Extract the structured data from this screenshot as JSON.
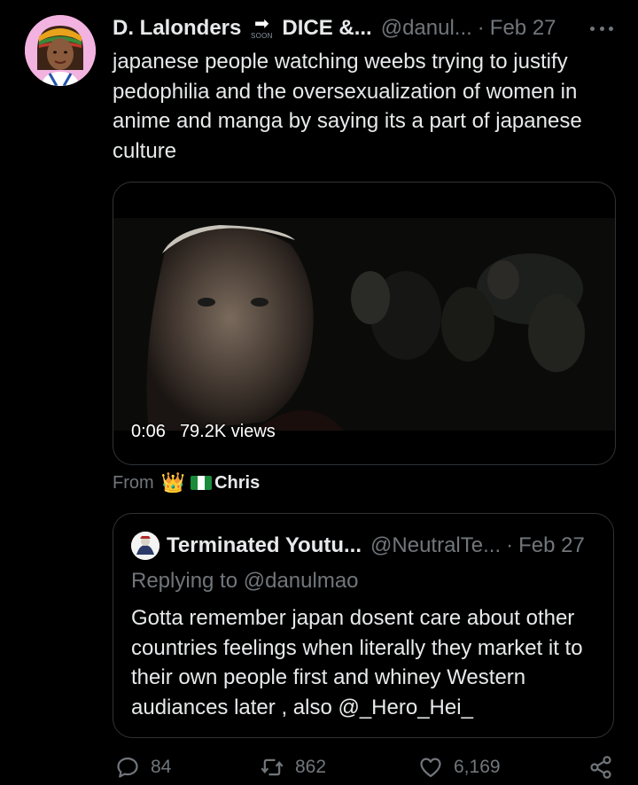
{
  "tweet": {
    "author_name": "D. Lalonders",
    "soon_badge": "SOON",
    "author_name_suffix": "DICE &...",
    "handle": "@danul...",
    "separator": "·",
    "date": "Feb 27",
    "text": "japanese people watching weebs trying to justify pedophilia and the oversexualization of women in anime and manga by saying its a part of japanese culture"
  },
  "video": {
    "duration": "0:06",
    "views": "79.2K views"
  },
  "from": {
    "label": "From",
    "name": "Chris"
  },
  "quote": {
    "author_name": "Terminated Youtu...",
    "handle": "@NeutralTe...",
    "separator": "·",
    "date": "Feb 27",
    "replying_to": "Replying to @danulmao",
    "text": "Gotta remember japan dosent care about other countries feelings when literally they market it to their own people first and whiney Western audiances later , also @_Hero_Hei_"
  },
  "actions": {
    "replies": "84",
    "retweets": "862",
    "likes": "6,169"
  },
  "icons": [
    "more-icon",
    "arrow-icon",
    "crown-icon",
    "flag-icon",
    "reply-icon",
    "retweet-icon",
    "like-icon",
    "share-icon"
  ],
  "colors": {
    "background": "#000000",
    "text": "#e7e9ea",
    "secondary": "#71767b",
    "border": "#2f3336",
    "avatar_bg": "#f3b3e0"
  }
}
